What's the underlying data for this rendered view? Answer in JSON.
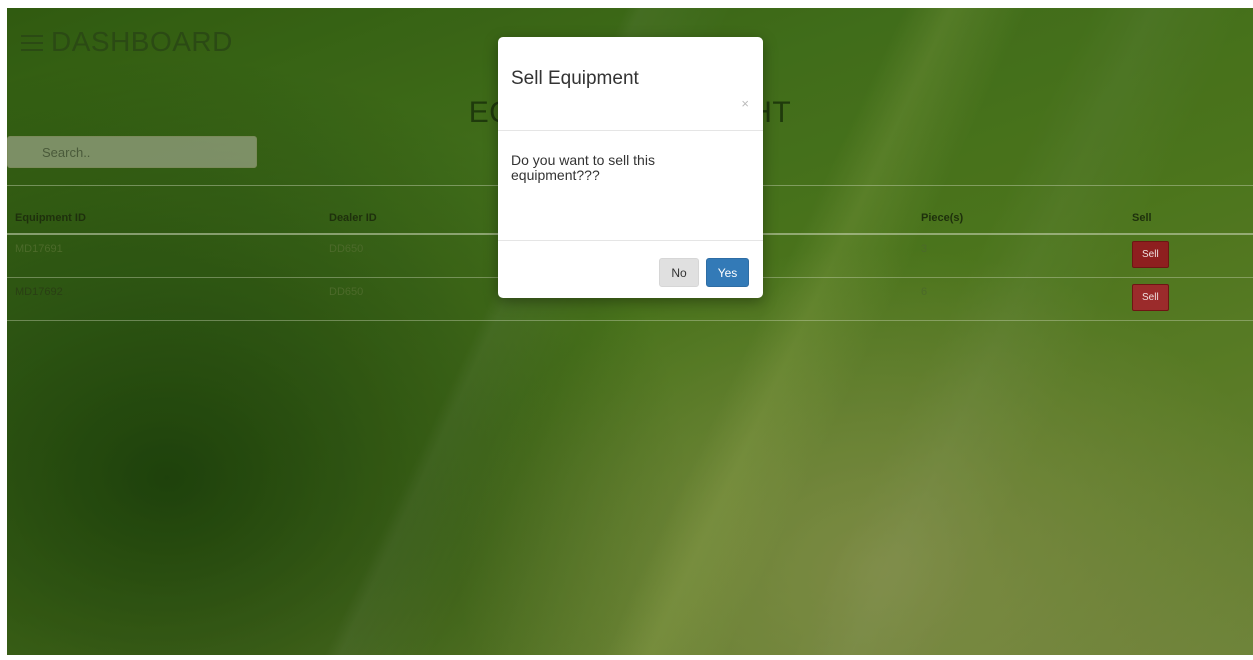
{
  "header": {
    "hamburger_icon": "hamburger-menu-icon",
    "dashboard_label": "DASHBOARD"
  },
  "page": {
    "heading": "EQUIPMENT BOUGHT"
  },
  "search": {
    "placeholder": "Search.."
  },
  "table": {
    "columns": [
      "Equipment ID",
      "Dealer ID",
      "",
      "Piece(s)",
      "Sell"
    ],
    "rows": [
      {
        "equipment_id": "MD17691",
        "dealer_id": "DD650",
        "pieces": "3",
        "sell_label": "Sell"
      },
      {
        "equipment_id": "MD17692",
        "dealer_id": "DD650",
        "pieces": "6",
        "sell_label": "Sell"
      }
    ]
  },
  "modal": {
    "title": "Sell Equipment",
    "close_symbol": "×",
    "message": "Do you want to sell this equipment???",
    "no_label": "No",
    "yes_label": "Yes"
  },
  "colors": {
    "sell_button": "#8e1f1f",
    "yes_button": "#337ab7",
    "no_button": "#e0e0e0"
  }
}
